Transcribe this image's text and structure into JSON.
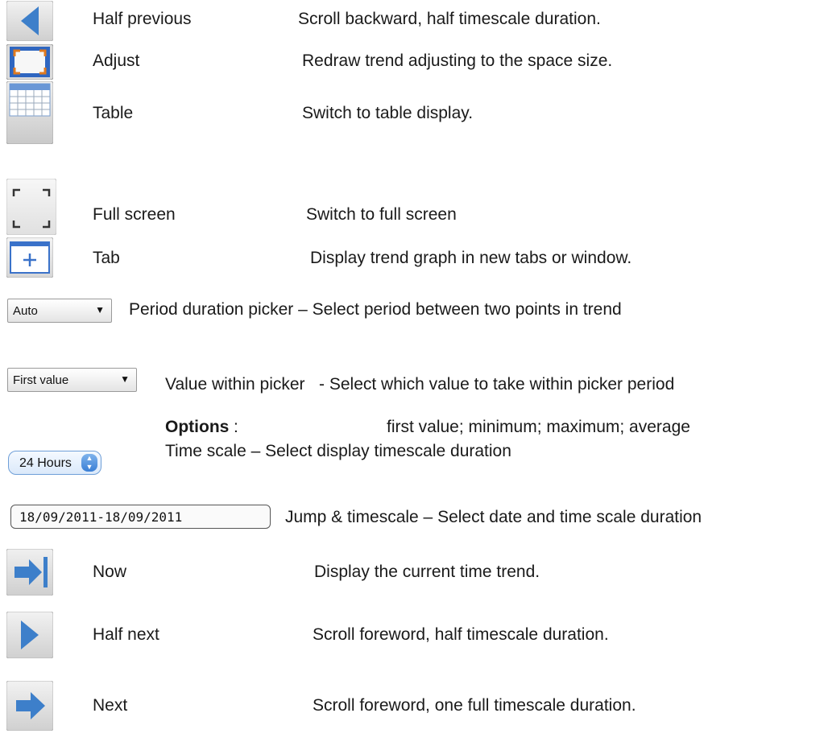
{
  "items": [
    {
      "icon": "half-previous-icon",
      "name": "Half previous",
      "desc": "Scroll backward, half timescale duration."
    },
    {
      "icon": "adjust-icon",
      "name": "Adjust",
      "desc": "Redraw trend adjusting to the space size."
    },
    {
      "icon": "table-icon",
      "name": "Table",
      "desc": "Switch to table display."
    },
    {
      "icon": "full-screen-icon",
      "name": "Full screen",
      "desc": "Switch to full screen"
    },
    {
      "icon": "tab-icon",
      "name": "Tab",
      "desc": "Display trend graph in new tabs or window."
    },
    {
      "icon": "period-picker",
      "control_value": "Auto",
      "desc": "Period duration picker – Select period between two points in trend"
    },
    {
      "icon": "value-picker",
      "control_value": "First value",
      "desc": "Value within picker   - Select which value to take within picker period"
    },
    {
      "icon": "timescale-picker",
      "control_value": "24 Hours",
      "desc": "Time scale – Select display timescale duration"
    },
    {
      "icon": "date-range-field",
      "control_value": "18/09/2011-18/09/2011",
      "desc": "Jump & timescale – Select date and time scale duration"
    },
    {
      "icon": "now-icon",
      "name": "Now",
      "desc": "Display the current time trend."
    },
    {
      "icon": "half-next-icon",
      "name": "Half next",
      "desc": "Scroll foreword, half timescale duration."
    },
    {
      "icon": "next-icon",
      "name": "Next",
      "desc": "Scroll foreword, one full timescale duration."
    }
  ],
  "options": {
    "label": "Options",
    "colon": ":",
    "values": "first value; minimum; maximum; average"
  },
  "colors": {
    "arrow_blue": "#4a86c8",
    "button_gray": "#d8d8d8",
    "accent_orange": "#e07a1f"
  }
}
